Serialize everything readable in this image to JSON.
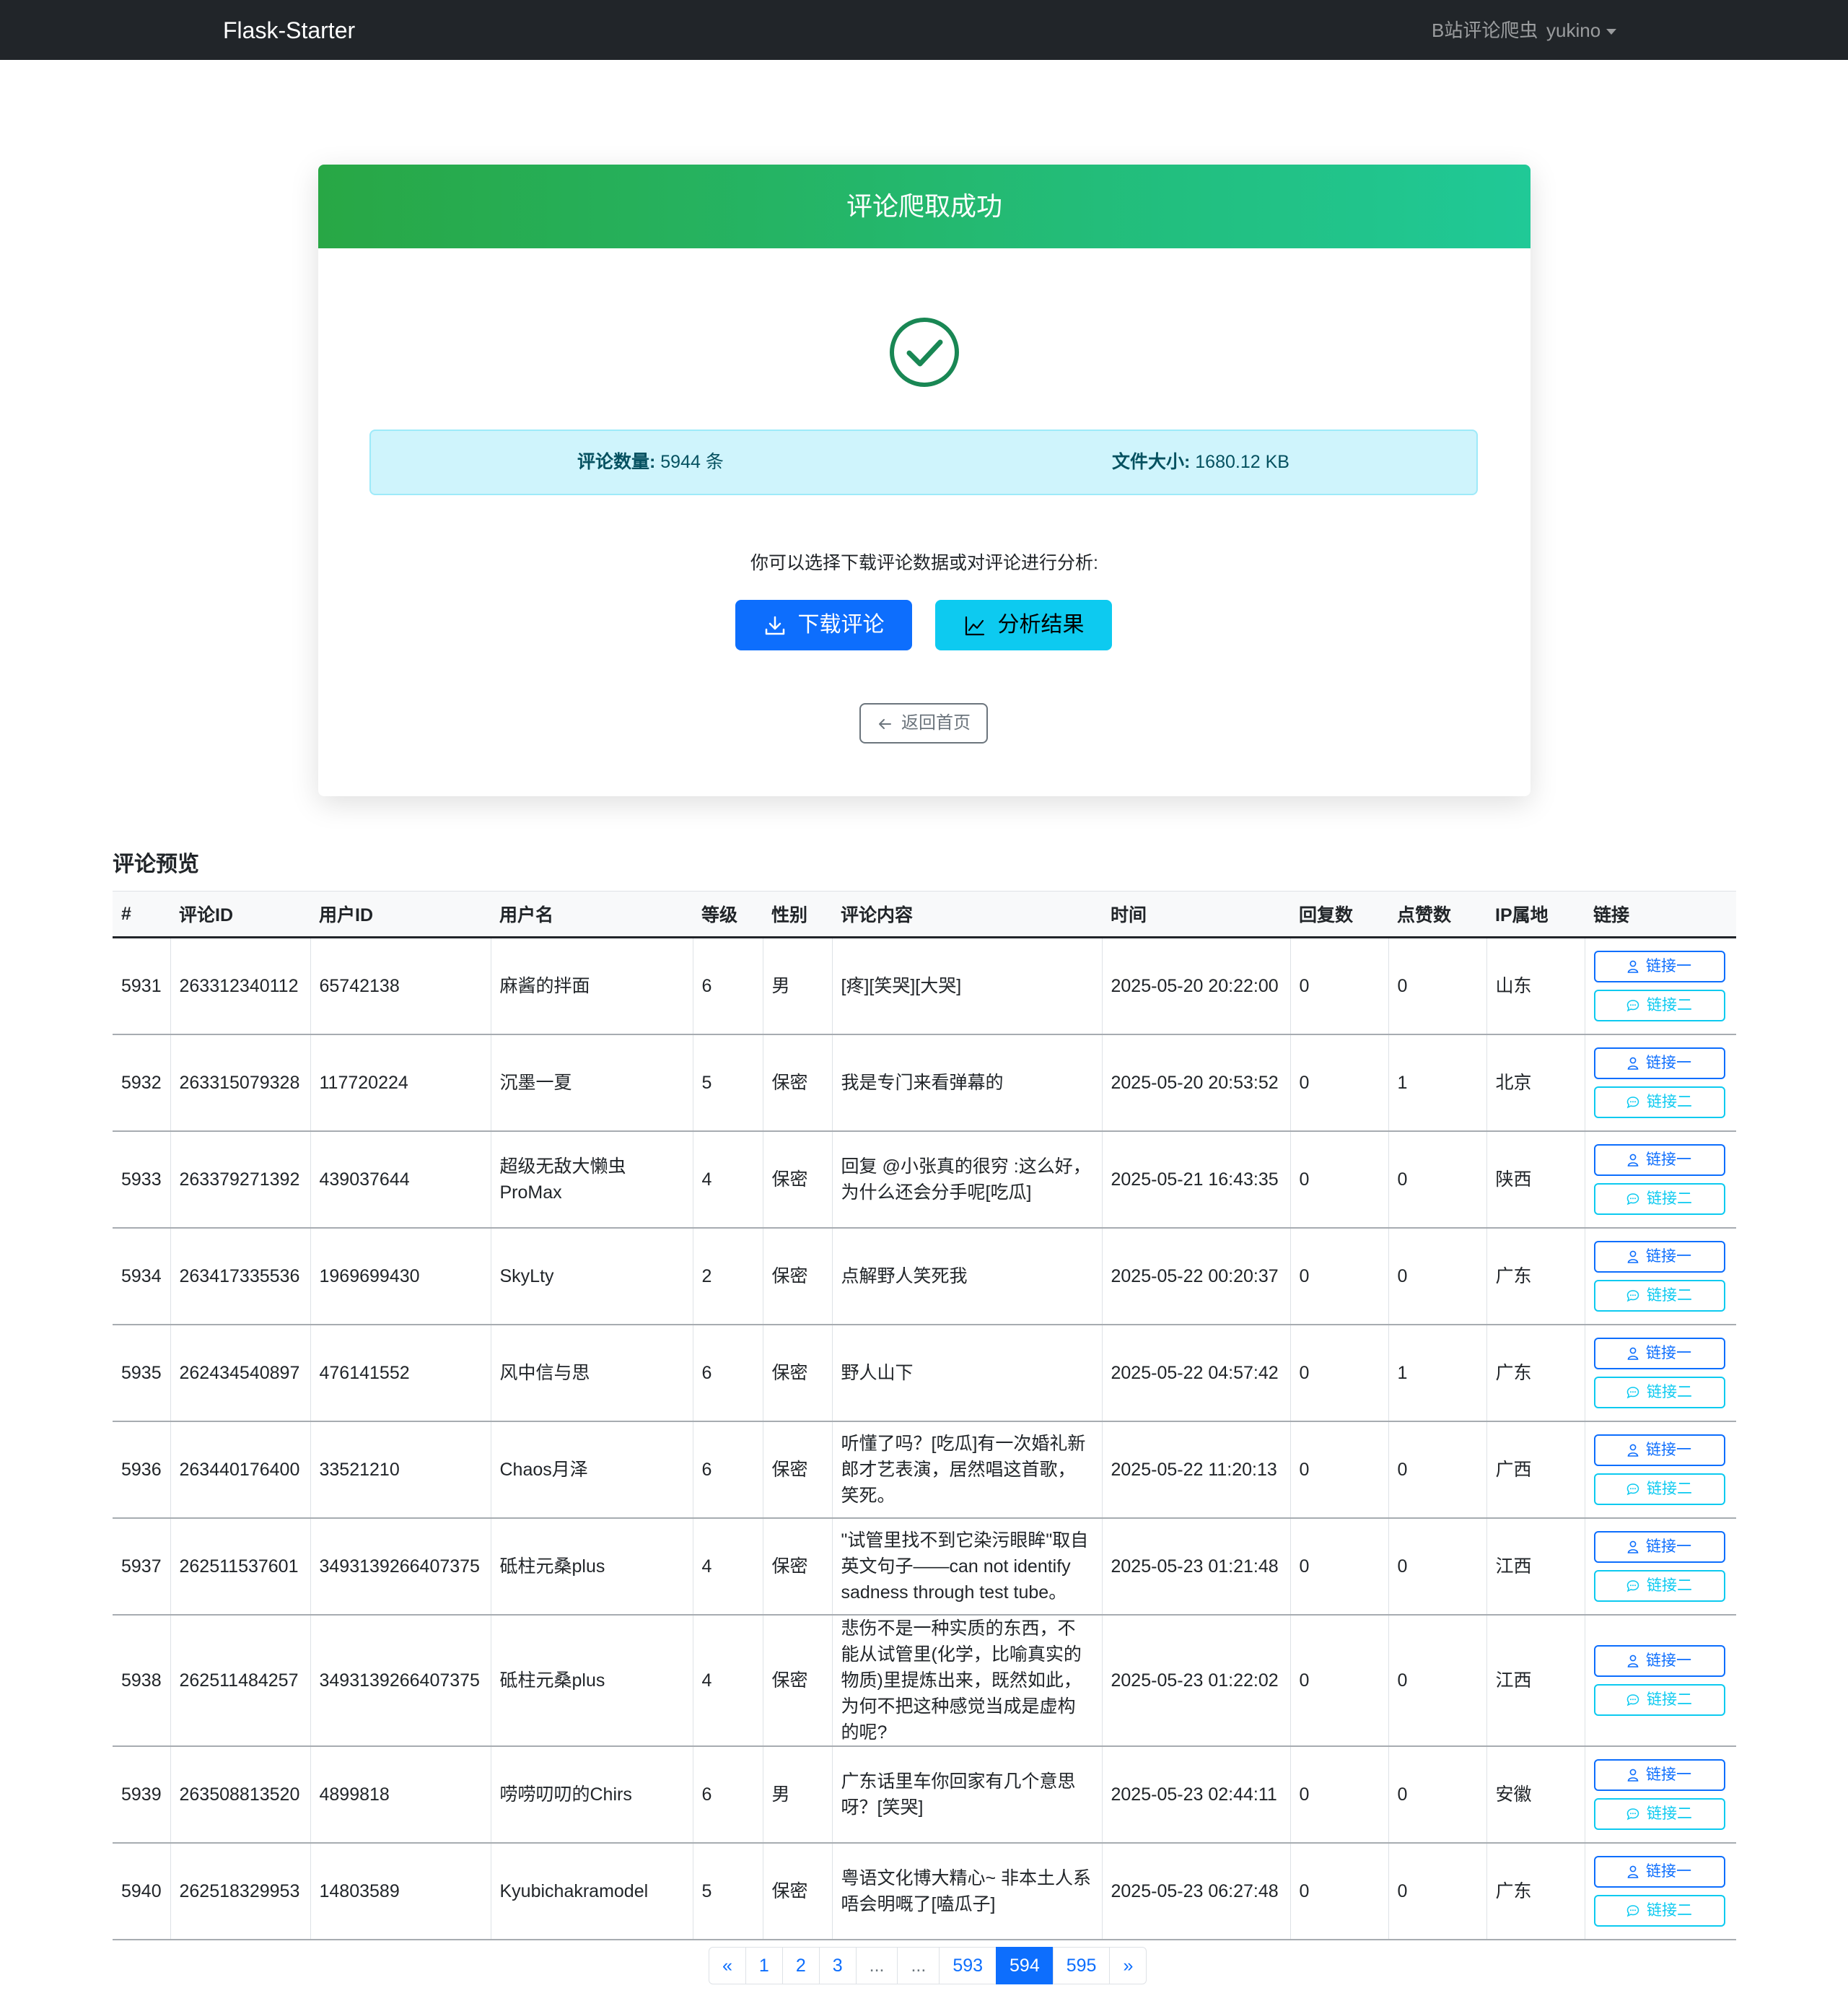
{
  "navbar": {
    "brand": "Flask-Starter",
    "crawler_link": "B站评论爬虫",
    "user": "yukino"
  },
  "card": {
    "title": "评论爬取成功",
    "count_label": "评论数量:",
    "count_value": "5944 条",
    "size_label": "文件大小:",
    "size_value": "1680.12 KB",
    "hint": "你可以选择下载评论数据或对评论进行分析:",
    "download_label": "下载评论",
    "analyze_label": "分析结果",
    "back_label": "返回首页"
  },
  "preview": {
    "title": "评论预览",
    "columns": [
      "#",
      "评论ID",
      "用户ID",
      "用户名",
      "等级",
      "性别",
      "评论内容",
      "时间",
      "回复数",
      "点赞数",
      "IP属地",
      "链接"
    ],
    "link1": "链接一",
    "link2": "链接二",
    "rows": [
      {
        "no": "5931",
        "cid": "263312340112",
        "uid": "65742138",
        "name": "麻酱的拌面",
        "level": "6",
        "gender": "男",
        "content": "[疼][笑哭][大哭]",
        "time": "2025-05-20 20:22:00",
        "replies": "0",
        "likes": "0",
        "ip": "山东"
      },
      {
        "no": "5932",
        "cid": "263315079328",
        "uid": "117720224",
        "name": "沉墨一夏",
        "level": "5",
        "gender": "保密",
        "content": "我是专门来看弹幕的",
        "time": "2025-05-20 20:53:52",
        "replies": "0",
        "likes": "1",
        "ip": "北京"
      },
      {
        "no": "5933",
        "cid": "263379271392",
        "uid": "439037644",
        "name": "超级无敌大懒虫ProMax",
        "level": "4",
        "gender": "保密",
        "content": "回复 @小张真的很穷 :这么好，为什么还会分手呢[吃瓜]",
        "time": "2025-05-21 16:43:35",
        "replies": "0",
        "likes": "0",
        "ip": "陕西"
      },
      {
        "no": "5934",
        "cid": "263417335536",
        "uid": "1969699430",
        "name": "SkyLty",
        "level": "2",
        "gender": "保密",
        "content": "点解野人笑死我",
        "time": "2025-05-22 00:20:37",
        "replies": "0",
        "likes": "0",
        "ip": "广东"
      },
      {
        "no": "5935",
        "cid": "262434540897",
        "uid": "476141552",
        "name": "风中信与思",
        "level": "6",
        "gender": "保密",
        "content": "野人山下",
        "time": "2025-05-22 04:57:42",
        "replies": "0",
        "likes": "1",
        "ip": "广东"
      },
      {
        "no": "5936",
        "cid": "263440176400",
        "uid": "33521210",
        "name": "Chaos月泽",
        "level": "6",
        "gender": "保密",
        "content": "听懂了吗？[吃瓜]有一次婚礼新郎才艺表演，居然唱这首歌，笑死。",
        "time": "2025-05-22 11:20:13",
        "replies": "0",
        "likes": "0",
        "ip": "广西"
      },
      {
        "no": "5937",
        "cid": "262511537601",
        "uid": "3493139266407375",
        "name": "砥柱元桑plus",
        "level": "4",
        "gender": "保密",
        "content": "\"试管里找不到它染污眼眸\"取自英文句子——can not identify sadness through test tube。",
        "time": "2025-05-23 01:21:48",
        "replies": "0",
        "likes": "0",
        "ip": "江西"
      },
      {
        "no": "5938",
        "cid": "262511484257",
        "uid": "3493139266407375",
        "name": "砥柱元桑plus",
        "level": "4",
        "gender": "保密",
        "content": "悲伤不是一种实质的东西，不能从试管里(化学，比喻真实的物质)里提炼出来，既然如此，为何不把这种感觉当成是虚构的呢?",
        "time": "2025-05-23 01:22:02",
        "replies": "0",
        "likes": "0",
        "ip": "江西"
      },
      {
        "no": "5939",
        "cid": "263508813520",
        "uid": "4899818",
        "name": "唠唠叨叨的Chirs",
        "level": "6",
        "gender": "男",
        "content": "广东话里车你回家有几个意思呀？[笑哭]",
        "time": "2025-05-23 02:44:11",
        "replies": "0",
        "likes": "0",
        "ip": "安徽"
      },
      {
        "no": "5940",
        "cid": "262518329953",
        "uid": "14803589",
        "name": "Kyubichakramodel",
        "level": "5",
        "gender": "保密",
        "content": "粤语文化博大精心~ 非本土人系唔会明嘅了[嗑瓜子]",
        "time": "2025-05-23 06:27:48",
        "replies": "0",
        "likes": "0",
        "ip": "广东"
      }
    ]
  },
  "pagination": [
    "«",
    "1",
    "2",
    "3",
    "...",
    "...",
    "593",
    "594",
    "595",
    "»"
  ],
  "pagination_active": "594",
  "colors": {
    "success_start": "#28a745",
    "success_end": "#20c997",
    "primary": "#0d6efd",
    "info": "#0dcaf0",
    "navbar": "#212529"
  },
  "icons": {
    "check": "check-circle-icon",
    "download": "download-icon",
    "chart": "chart-line-icon",
    "back": "arrow-left-icon",
    "link1": "person-icon",
    "link2": "chat-icon"
  }
}
